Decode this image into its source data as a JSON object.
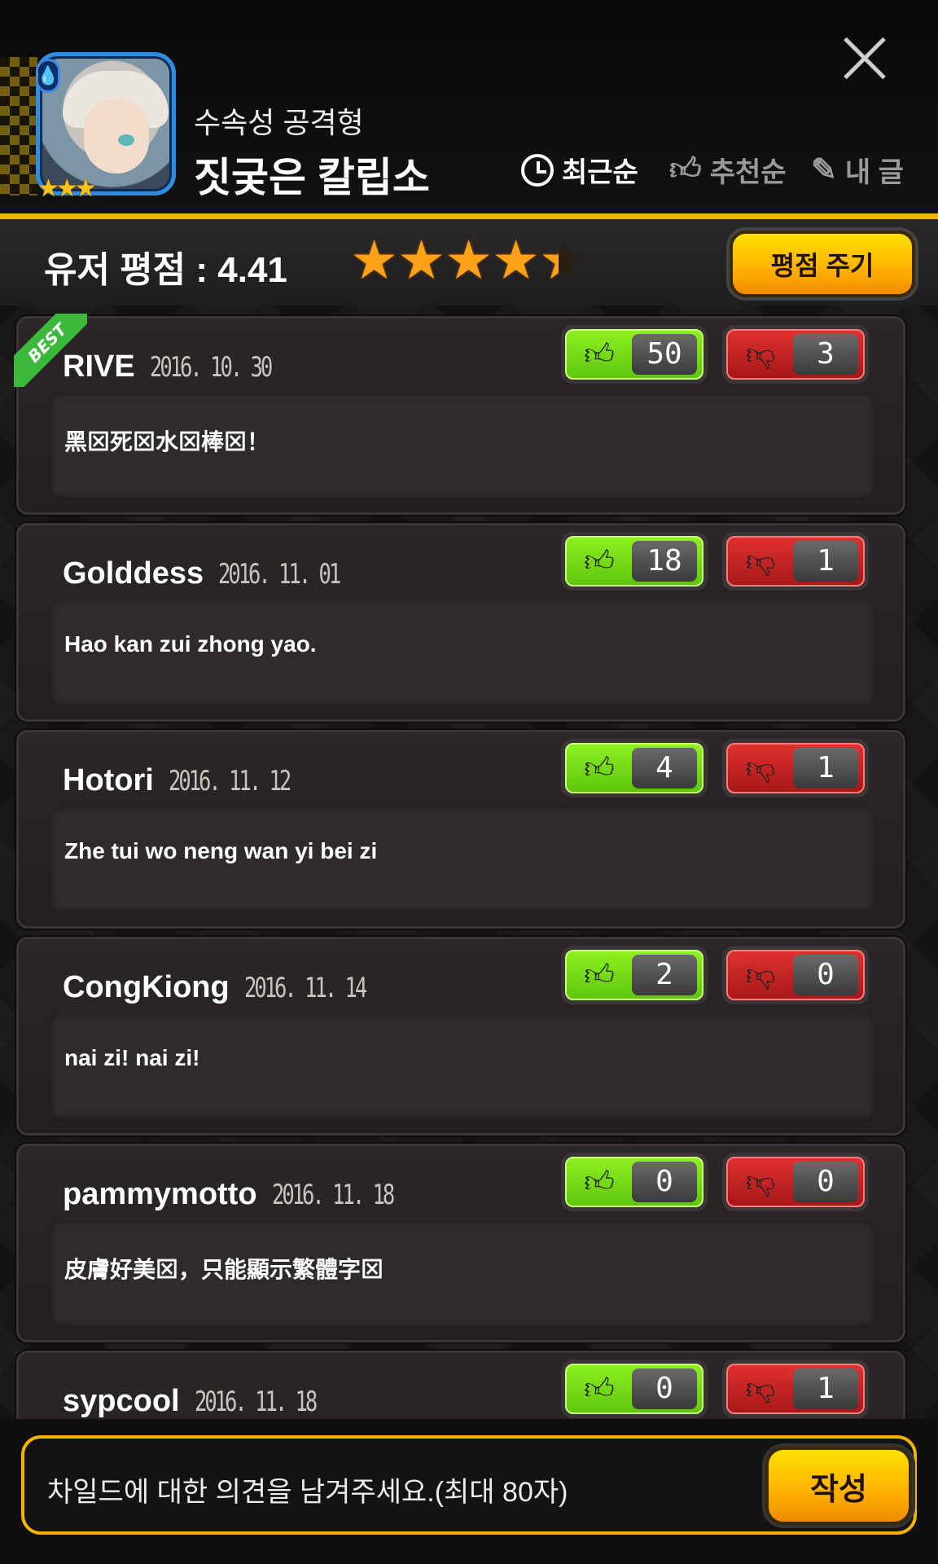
{
  "header": {
    "attribute": "수속성 공격형",
    "child_name": "짓궂은 칼립소",
    "portrait_stars": "★★★",
    "sort_tabs": [
      {
        "label": "최근순",
        "icon": "clock-icon",
        "active": true
      },
      {
        "label": "추천순",
        "icon": "thumbs-up-icon",
        "active": false
      },
      {
        "label": "내 글",
        "icon": "pencil-icon",
        "active": false
      }
    ]
  },
  "rating": {
    "label": "유저 평점 : 4.41",
    "value": 4.41,
    "max": 5,
    "button": "평점 주기"
  },
  "reviews": [
    {
      "user": "RIVE",
      "date": "2016. 10. 30",
      "text": "黑⊠死⊠水⊠棒⊠！",
      "up": "50",
      "down": "3",
      "best": "BEST"
    },
    {
      "user": "Golddess",
      "date": "2016. 11. 01",
      "text": "Hao kan zui zhong yao.",
      "up": "18",
      "down": "1"
    },
    {
      "user": "Hotori",
      "date": "2016. 11. 12",
      "text": "Zhe tui wo neng wan yi bei zi",
      "up": "4",
      "down": "1"
    },
    {
      "user": "CongKiong",
      "date": "2016. 11. 14",
      "text": "nai zi! nai zi!",
      "up": "2",
      "down": "0"
    },
    {
      "user": "pammymotto",
      "date": "2016. 11. 18",
      "text": "皮膚好美⊠，只能顯示繁體字⊠",
      "up": "0",
      "down": "0"
    },
    {
      "user": "sypcool",
      "date": "2016. 11. 18",
      "text": "",
      "up": "0",
      "down": "1"
    }
  ],
  "comment_input": {
    "placeholder": "차일드에 대한 의견을 남겨주세요.(최대 80자)",
    "submit": "작성"
  },
  "colors": {
    "accent_gold": "#f0b400",
    "upvote_green": "#6fd616",
    "downvote_red": "#c42222",
    "star_orange": "#ffa21a"
  }
}
